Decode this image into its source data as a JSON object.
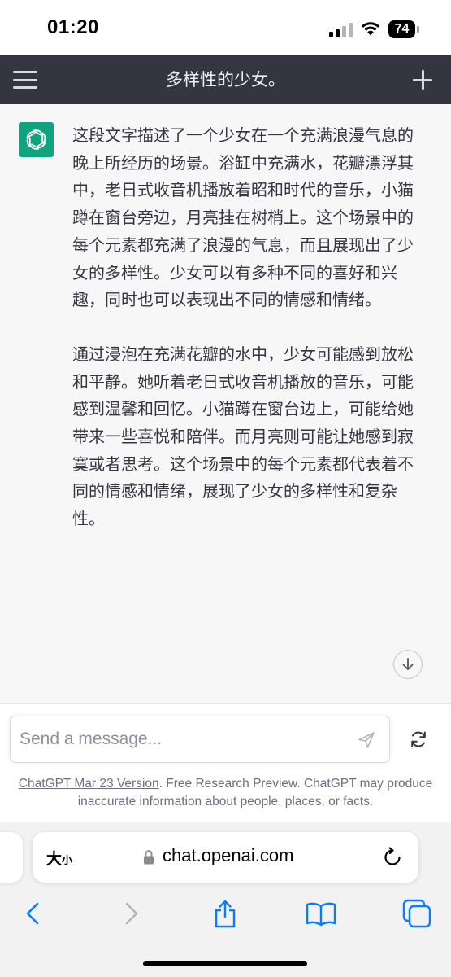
{
  "status_bar": {
    "time": "01:20",
    "battery": "74"
  },
  "header": {
    "title": "多样性的少女。"
  },
  "conversation": {
    "paragraphs": [
      "这段文字描述了一个少女在一个充满浪漫气息的晚上所经历的场景。浴缸中充满水，花瓣漂浮其中，老日式收音机播放着昭和时代的音乐，小猫蹲在窗台旁边，月亮挂在树梢上。这个场景中的每个元素都充满了浪漫的气息，而且展现出了少女的多样性。少女可以有多种不同的喜好和兴趣，同时也可以表现出不同的情感和情绪。",
      "通过浸泡在充满花瓣的水中，少女可能感到放松和平静。她听着老日式收音机播放的音乐，可能感到温馨和回忆。小猫蹲在窗台边上，可能给她带来一些喜悦和陪伴。而月亮则可能让她感到寂寞或者思考。这个场景中的每个元素都代表着不同的情感和情绪，展现了少女的多样性和复杂性。"
    ]
  },
  "composer": {
    "placeholder": "Send a message...",
    "footer_link": "ChatGPT Mar 23 Version",
    "footer_text": ". Free Research Preview. ChatGPT may produce inaccurate information about people, places, or facts."
  },
  "browser": {
    "text_size_large": "大",
    "text_size_small": "小",
    "url": "chat.openai.com"
  },
  "colors": {
    "header_bg": "#343541",
    "accent_green": "#10a37f",
    "chat_bg": "#f7f7f8",
    "ios_blue": "#0a7aff"
  },
  "icons": {
    "menu": "menu-icon",
    "new_chat": "plus-icon",
    "avatar": "openai-logo-icon",
    "send": "send-icon",
    "regenerate": "refresh-icon",
    "back": "chevron-left-icon",
    "forward": "chevron-right-icon",
    "share": "share-icon",
    "bookmarks": "book-icon",
    "tabs": "tabs-icon"
  }
}
